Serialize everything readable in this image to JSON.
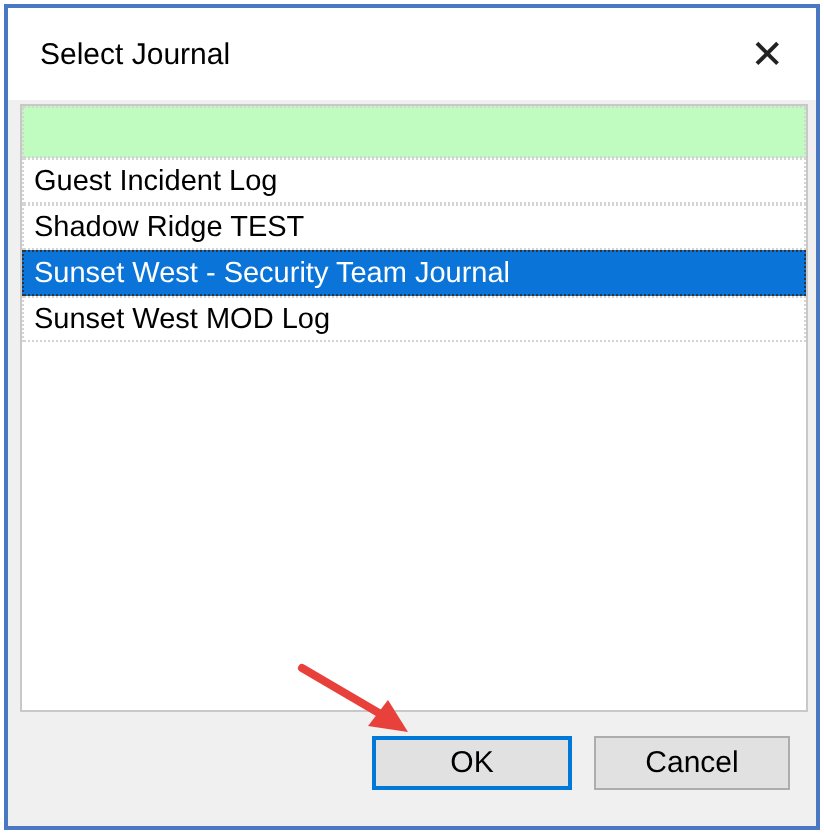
{
  "window": {
    "title": "Select Journal",
    "close": "✕"
  },
  "journals": [
    {
      "color": "#c0fcc0",
      "selected": false
    },
    {
      "label": "Guest Incident Log",
      "selected": false
    },
    {
      "label": "Shadow Ridge TEST",
      "selected": false
    },
    {
      "label": "Sunset West - Security Team Journal",
      "selected": true
    },
    {
      "label": "Sunset West MOD Log",
      "selected": false
    }
  ],
  "buttons": [
    {
      "label": "OK",
      "default": true
    },
    {
      "label": "Cancel",
      "default": false
    }
  ]
}
